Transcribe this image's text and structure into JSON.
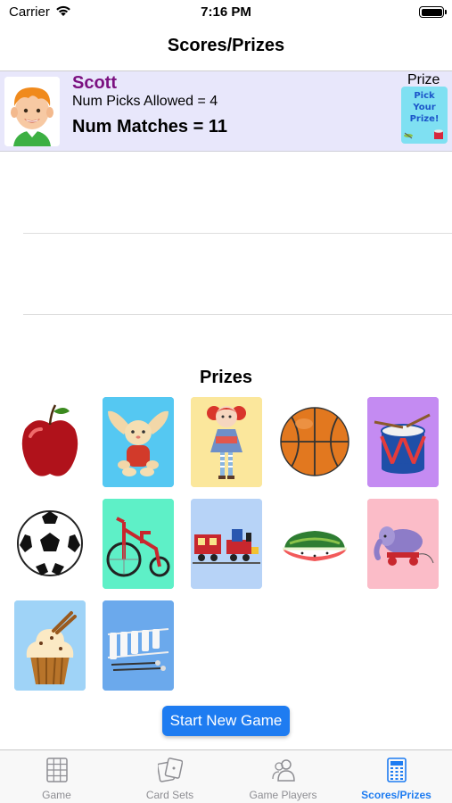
{
  "status_bar": {
    "carrier": "Carrier",
    "time": "7:16 PM"
  },
  "nav": {
    "title": "Scores/Prizes"
  },
  "player": {
    "name": "Scott",
    "picks_text": "Num Picks Allowed = 4",
    "matches_text": "Num Matches = 11",
    "prize_label": "Prize",
    "prize_card_lines": [
      "Pick",
      "Your",
      "Prize!"
    ]
  },
  "prizes": {
    "heading": "Prizes",
    "items": [
      {
        "icon": "apple-icon",
        "bg": "#ffffff"
      },
      {
        "icon": "bunny-plush-icon",
        "bg": "#55c8f2"
      },
      {
        "icon": "doll-icon",
        "bg": "#fbe79c"
      },
      {
        "icon": "basketball-icon",
        "bg": "#ffffff"
      },
      {
        "icon": "drum-icon",
        "bg": "#c48bf2"
      },
      {
        "icon": "soccer-ball-icon",
        "bg": "#ffffff"
      },
      {
        "icon": "tricycle-icon",
        "bg": "#5ef0c7"
      },
      {
        "icon": "toy-train-icon",
        "bg": "#b7d3f7"
      },
      {
        "icon": "watermelon-icon",
        "bg": "#ffffff"
      },
      {
        "icon": "elephant-pull-toy-icon",
        "bg": "#fbbcc8"
      },
      {
        "icon": "cupcake-icon",
        "bg": "#9fd3f7"
      },
      {
        "icon": "xylophone-icon",
        "bg": "#6ba9ec"
      }
    ]
  },
  "start_button": {
    "label": "Start New Game"
  },
  "tabs": [
    {
      "label": "Game",
      "icon": "grid-icon",
      "active": false
    },
    {
      "label": "Card Sets",
      "icon": "cards-icon",
      "active": false
    },
    {
      "label": "Game Players",
      "icon": "players-icon",
      "active": false
    },
    {
      "label": "Scores/Prizes",
      "icon": "calculator-icon",
      "active": true
    }
  ],
  "colors": {
    "accent": "#1e7cf1",
    "player_row_bg": "#e8e7fb",
    "player_name": "#7b1180"
  }
}
